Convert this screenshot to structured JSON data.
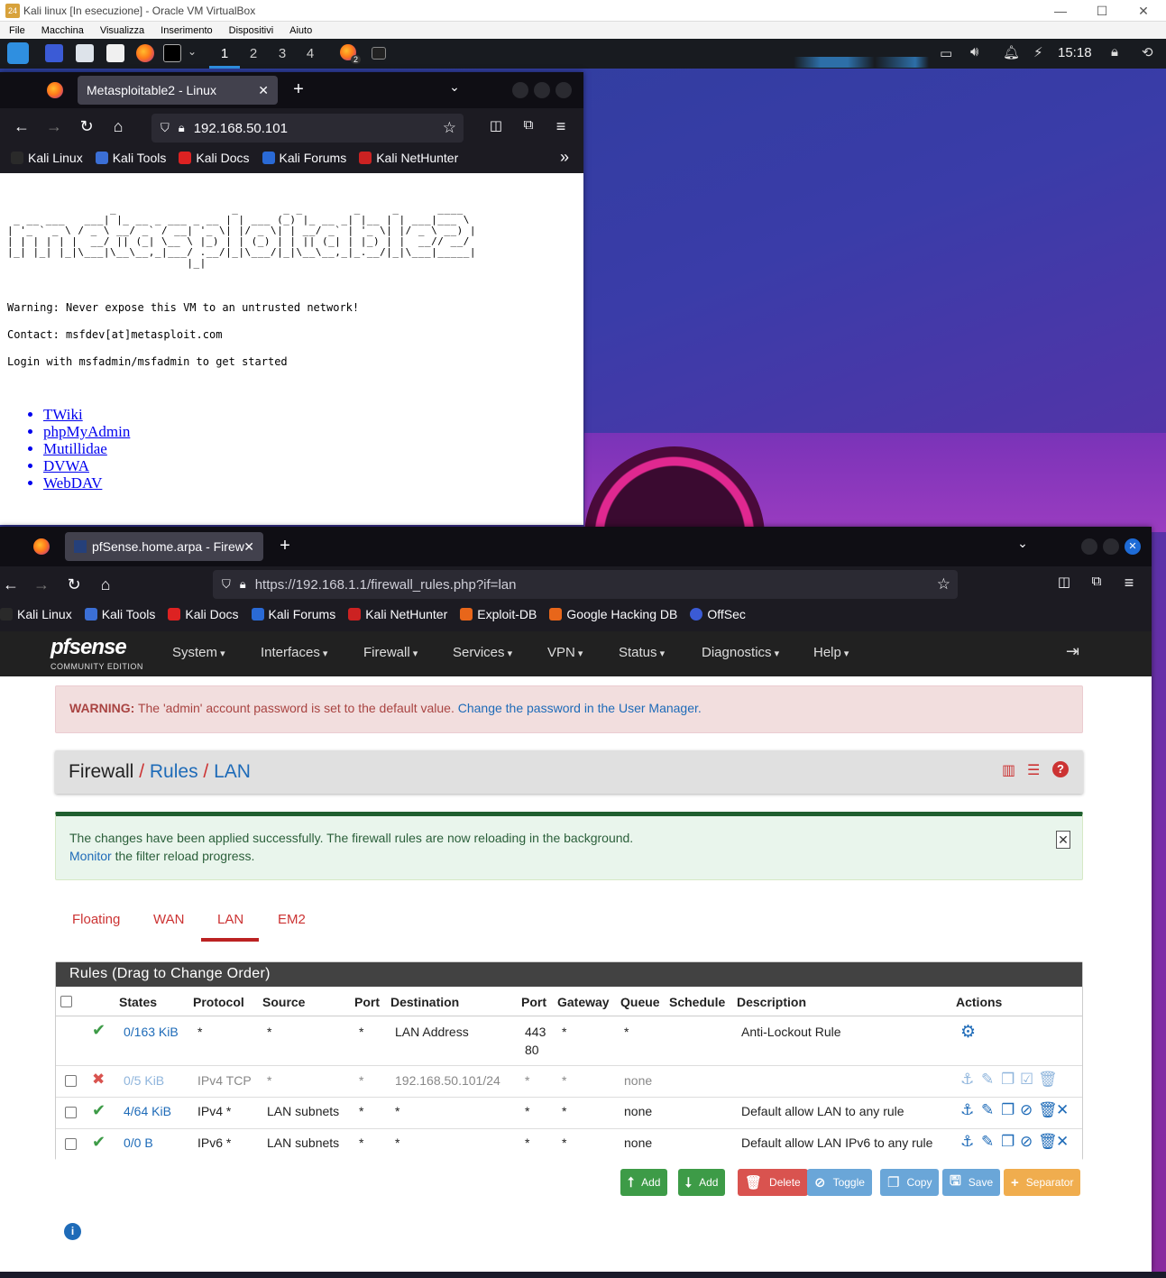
{
  "vbox": {
    "title": "Kali linux [In esecuzione] - Oracle VM VirtualBox",
    "menu": [
      "File",
      "Macchina",
      "Visualizza",
      "Inserimento",
      "Dispositivi",
      "Aiuto"
    ],
    "controls": [
      "—",
      "☐",
      "✕"
    ]
  },
  "taskbar": {
    "workspaces": [
      "1",
      "2",
      "3",
      "4"
    ],
    "clock": "15:18",
    "badge": "2"
  },
  "win1": {
    "tab_title": "Metasploitable2 - Linux",
    "url": "192.168.50.101",
    "bookmarks": [
      "Kali Linux",
      "Kali Tools",
      "Kali Docs",
      "Kali Forums",
      "Kali NetHunter"
    ],
    "ascii": "                _                  _       _ _        _     _      ____  \n _ __ ___   ___| |_ __ _ ___ _ __ | | ___ (_) |_ __ _| |__ | | ___|___ \\ \n| '_ ` _ \\ / _ \\ __/ _` / __| '_ \\| |/ _ \\| | __/ _` | '_ \\| |/ _ \\ __) |\n| | | | | |  __/ || (_| \\__ \\ |_) | | (_) | | || (_| | |_) | |  __// __/ \n|_| |_| |_|\\___|\\__\\__,_|___/ .__/|_|\\___/|_|\\__\\__,_|_.__/|_|\\___|_____|\n                            |_|                                          ",
    "warning": "Warning: Never expose this VM to an untrusted network!",
    "contact": "Contact: msfdev[at]metasploit.com",
    "login": "Login with msfadmin/msfadmin to get started",
    "links": [
      "TWiki",
      "phpMyAdmin",
      "Mutillidae",
      "DVWA",
      "WebDAV"
    ]
  },
  "win2": {
    "tab_title": "pfSense.home.arpa - Firew",
    "url": "https://192.168.1.1/firewall_rules.php?if=lan",
    "bookmarks": [
      "Kali Linux",
      "Kali Tools",
      "Kali Docs",
      "Kali Forums",
      "Kali NetHunter",
      "Exploit-DB",
      "Google Hacking DB",
      "OffSec"
    ]
  },
  "pfsense": {
    "logo": "pfsense",
    "logo_sub": "COMMUNITY EDITION",
    "menu": [
      "System",
      "Interfaces",
      "Firewall",
      "Services",
      "VPN",
      "Status",
      "Diagnostics",
      "Help"
    ],
    "warning_label": "WARNING:",
    "warning_text": "The 'admin' account password is set to the default value.",
    "warning_link": "Change the password in the User Manager.",
    "breadcrumb": {
      "root": "Firewall",
      "sep": "/",
      "mid": "Rules",
      "leaf": "LAN"
    },
    "success_line1": "The changes have been applied successfully. The firewall rules are now reloading in the background.",
    "success_link": "Monitor",
    "success_line2": " the filter reload progress.",
    "tabs": [
      "Floating",
      "WAN",
      "LAN",
      "EM2"
    ],
    "rules_title": "Rules (Drag to Change Order)",
    "headers": [
      "States",
      "Protocol",
      "Source",
      "Port",
      "Destination",
      "Port",
      "Gateway",
      "Queue",
      "Schedule",
      "Description",
      "Actions"
    ],
    "rows": [
      {
        "states": "0/163 KiB",
        "protocol": "*",
        "source": "*",
        "port": "*",
        "destination": "LAN Address",
        "dport": "443",
        "dport2": "80",
        "gateway": "*",
        "queue": "*",
        "schedule": "",
        "description": "Anti-Lockout Rule",
        "status": "pass"
      },
      {
        "states": "0/5 KiB",
        "protocol": "IPv4 TCP",
        "source": "*",
        "port": "*",
        "destination": "192.168.50.101/24",
        "dport": "*",
        "gateway": "*",
        "queue": "none",
        "schedule": "",
        "description": "",
        "status": "block"
      },
      {
        "states": "4/64 KiB",
        "protocol": "IPv4 *",
        "source": "LAN subnets",
        "port": "*",
        "destination": "*",
        "dport": "*",
        "gateway": "*",
        "queue": "none",
        "schedule": "",
        "description": "Default allow LAN to any rule",
        "status": "pass"
      },
      {
        "states": "0/0 B",
        "protocol": "IPv6 *",
        "source": "LAN subnets",
        "port": "*",
        "destination": "*",
        "dport": "*",
        "gateway": "*",
        "queue": "none",
        "schedule": "",
        "description": "Default allow LAN IPv6 to any rule",
        "status": "pass"
      }
    ],
    "buttons": [
      "Add",
      "Add",
      "Delete",
      "Toggle",
      "Copy",
      "Save",
      "Separator"
    ],
    "colors": {
      "nav": "#212121",
      "primary": "#1e6bb8",
      "success": "#3d9b47",
      "danger": "#d9534f",
      "info": "#5bc0de",
      "warning": "#f0ad4e"
    }
  }
}
